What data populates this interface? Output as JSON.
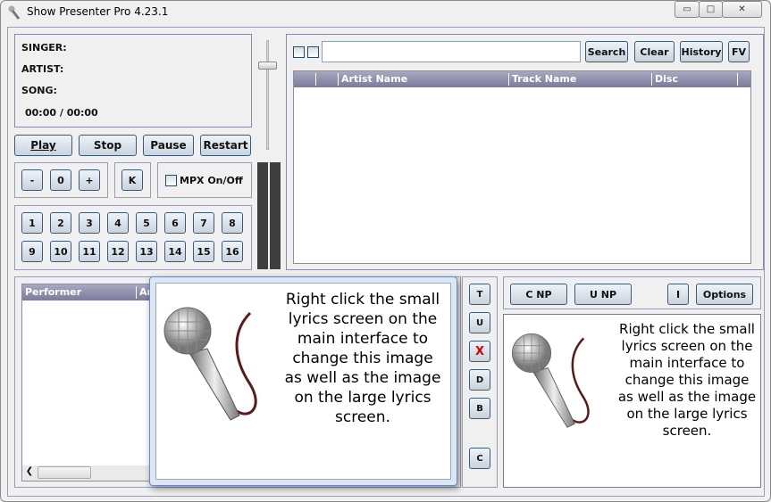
{
  "window": {
    "title": "Show Presenter Pro 4.23.1",
    "minimize": "▭",
    "maximize": "□",
    "close": "✕"
  },
  "info": {
    "singer_label": "SINGER:",
    "artist_label": "ARTIST:",
    "song_label": "SONG:",
    "time": "00:00 / 00:00"
  },
  "transport": {
    "play": "Play",
    "stop": "Stop",
    "pause": "Pause",
    "restart": "Restart"
  },
  "pitch": {
    "minus": "-",
    "zero": "0",
    "plus": "+"
  },
  "key_button": "K",
  "mpx": {
    "label": "MPX On/Off",
    "checked": false
  },
  "number_buttons": [
    "1",
    "2",
    "3",
    "4",
    "5",
    "6",
    "7",
    "8",
    "9",
    "10",
    "11",
    "12",
    "13",
    "14",
    "15",
    "16"
  ],
  "search": {
    "value": "",
    "search": "Search",
    "clear": "Clear",
    "history": "History",
    "fv": "FV"
  },
  "track_table": {
    "columns": [
      "",
      "Artist Name",
      "Track Name",
      "Disc",
      ""
    ],
    "rows": []
  },
  "performer_table": {
    "columns": [
      "Performer",
      "Ar"
    ],
    "rows": []
  },
  "side_buttons": [
    "T",
    "U",
    "X",
    "D",
    "B",
    "C"
  ],
  "np": {
    "cnp": "C NP",
    "unp": "U NP",
    "i": "I",
    "options": "Options"
  },
  "lyrics_text": "Right click the small lyrics screen on the main interface to change this image as well as the image on the large lyrics screen.",
  "colors": {
    "header": "#8a8aa8",
    "x_button": "#e00000",
    "cable": "#5a1a1a"
  }
}
